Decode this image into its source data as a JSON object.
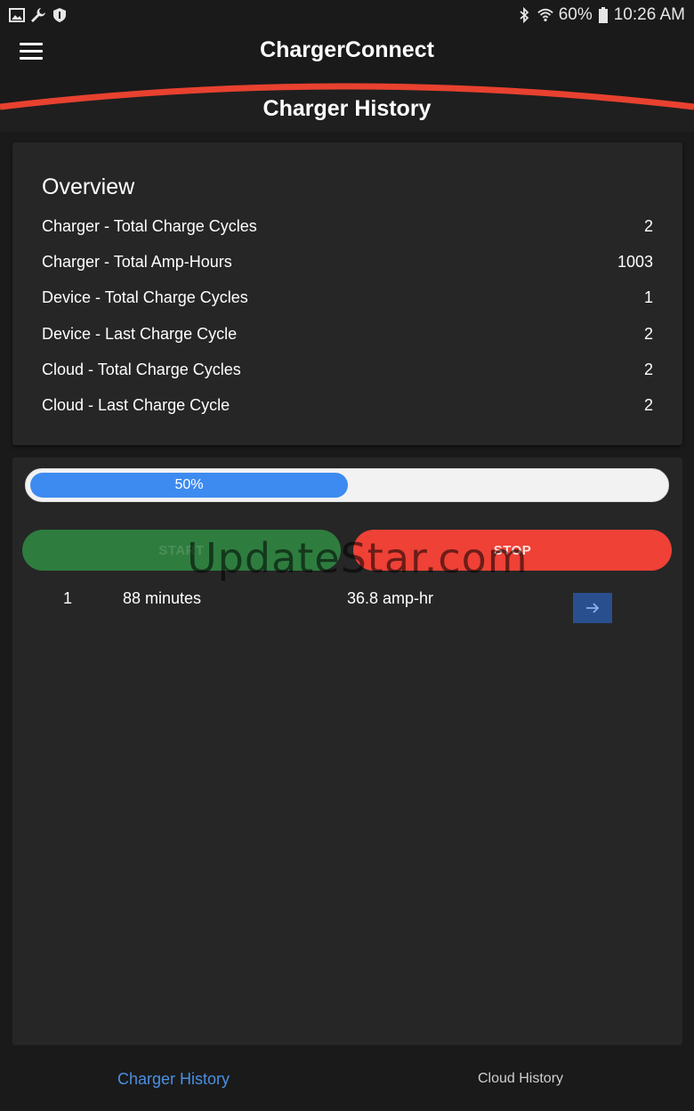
{
  "status_bar": {
    "battery": "60%",
    "time": "10:26 AM",
    "icons_left": [
      "image-icon",
      "wrench-icon",
      "shield-icon"
    ],
    "icons_right": [
      "bluetooth-icon",
      "wifi-icon",
      "battery-icon"
    ]
  },
  "header": {
    "app_title": "ChargerConnect",
    "page_title": "Charger History",
    "accent_color": "#e8412f"
  },
  "overview": {
    "title": "Overview",
    "rows": [
      {
        "label": "Charger - Total Charge Cycles",
        "value": "2"
      },
      {
        "label": "Charger - Total Amp-Hours",
        "value": "1003"
      },
      {
        "label": "Device - Total Charge Cycles",
        "value": "1"
      },
      {
        "label": "Device - Last Charge Cycle",
        "value": "2"
      },
      {
        "label": "Cloud - Total Charge Cycles",
        "value": "2"
      },
      {
        "label": "Cloud - Last Charge Cycle",
        "value": "2"
      }
    ]
  },
  "progress": {
    "label": "50%",
    "value": 0.5,
    "color": "#3d8bf0"
  },
  "controls": {
    "start_label": "START",
    "stop_label": "STOP"
  },
  "history": [
    {
      "index": "1",
      "duration": "88 minutes",
      "amp_hours": "36.8 amp-hr"
    }
  ],
  "watermark": "UpdateStar.com",
  "bottom_nav": {
    "tabs": [
      {
        "label": "Charger History",
        "active": true
      },
      {
        "label": "Cloud History",
        "active": false
      }
    ]
  }
}
